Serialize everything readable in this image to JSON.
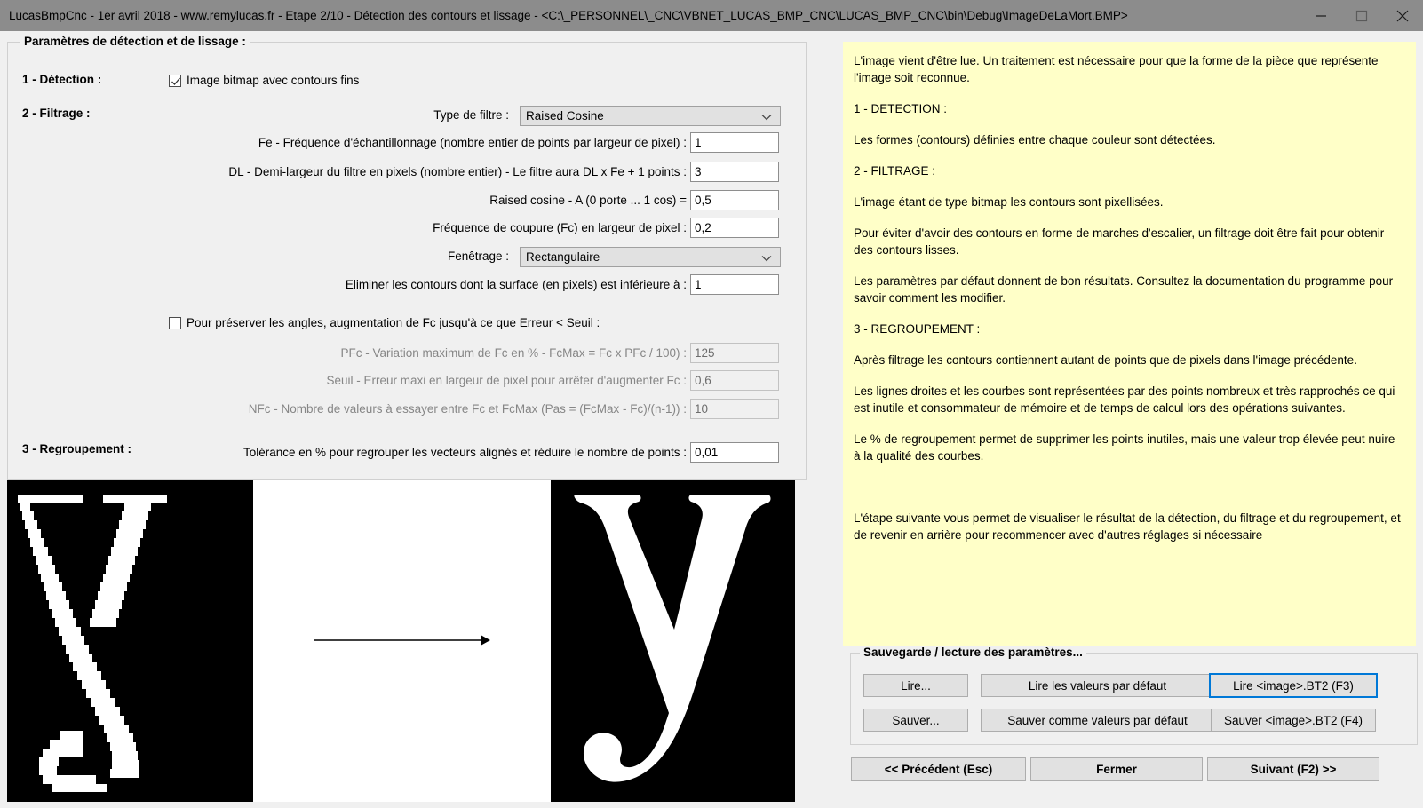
{
  "window": {
    "title": "LucasBmpCnc - 1er avril 2018 - www.remylucas.fr - Etape 2/10 - Détection des contours et lissage - <C:\\_PERSONNEL\\_CNC\\VBNET_LUCAS_BMP_CNC\\LUCAS_BMP_CNC\\bin\\Debug\\ImageDeLaMort.BMP>",
    "titlebar_color": "#8c8c8c",
    "minimize_icon": "minimize-icon",
    "maximize_icon": "maximize-icon",
    "close_icon": "close-icon"
  },
  "params_group": {
    "title": "Paramètres de détection et de lissage :",
    "section1_label": "1 - Détection :",
    "section2_label": "2 - Filtrage :",
    "section3_label": "3 - Regroupement :",
    "checkbox_thin_contours": {
      "label": "Image bitmap avec contours fins",
      "checked": true
    },
    "filter_type": {
      "label": "Type de filtre :",
      "value": "Raised Cosine"
    },
    "fe": {
      "label": "Fe - Fréquence d'échantillonnage (nombre entier de points par largeur de pixel) :",
      "value": "1"
    },
    "dl": {
      "label": "DL - Demi-largeur du filtre en pixels (nombre entier) - Le filtre aura DL x Fe + 1 points :",
      "value": "3"
    },
    "raised_cosine_a": {
      "label": "Raised cosine - A (0 porte ... 1 cos) =",
      "value": "0,5"
    },
    "fc": {
      "label": "Fréquence de coupure (Fc) en largeur de pixel :",
      "value": "0,2"
    },
    "windowing": {
      "label": "Fenêtrage :",
      "value": "Rectangulaire"
    },
    "min_surface": {
      "label": "Eliminer les contours dont la surface (en pixels) est inférieure à :",
      "value": "1"
    },
    "checkbox_preserve_angles": {
      "label": "Pour préserver les angles, augmentation de Fc jusqu'à ce que Erreur < Seuil :",
      "checked": false
    },
    "pfc": {
      "label": "PFc - Variation maximum de Fc en % - FcMax = Fc x PFc / 100) :",
      "value": "125",
      "disabled": true
    },
    "seuil": {
      "label": "Seuil - Erreur maxi en largeur de pixel pour arrêter d'augmenter Fc :",
      "value": "0,6",
      "disabled": true
    },
    "nfc": {
      "label": "NFc - Nombre de valeurs à essayer entre Fc et FcMax (Pas = (FcMax - Fc)/(n-1)) :",
      "value": "10",
      "disabled": true
    },
    "tolerance": {
      "label": "Tolérance en % pour regrouper les vecteurs alignés et réduire le nombre de points :",
      "value": "0,01"
    }
  },
  "preview": {
    "left_image_alt": "lettre-y-pixelisee",
    "right_image_alt": "lettre-y-lissee",
    "arrow_icon": "arrow-right-icon"
  },
  "help": {
    "background_color": "#ffffc8",
    "paragraphs": [
      "L'image vient d'être lue. Un traitement est nécessaire pour que la forme de la pièce que représente l'image soit reconnue.",
      "1 - DETECTION :",
      "Les formes (contours) définies entre chaque couleur sont détectées.",
      "2 - FILTRAGE :",
      "L'image étant de type bitmap les contours sont pixellisées.",
      "Pour éviter d'avoir des contours en forme de marches d'escalier, un filtrage doit être fait pour obtenir des contours lisses.",
      "Les paramètres par défaut donnent de bon résultats. Consultez la documentation du programme pour savoir comment les modifier.",
      "3 - REGROUPEMENT :",
      "Après filtrage les contours contiennent autant de points que de pixels dans l'image précédente.",
      "Les lignes droites et les courbes sont représentées par des points nombreux et très rapprochés ce qui est inutile et consommateur de mémoire et de temps de calcul lors des opérations suivantes.",
      "Le % de regroupement permet de supprimer les points inutiles, mais une valeur trop élevée peut nuire à la qualité des courbes.",
      "",
      "L'étape suivante vous permet de visualiser le résultat de la détection, du filtrage et du regroupement, et de revenir en arrière pour recommencer avec d'autres réglages si nécessaire"
    ]
  },
  "save_group": {
    "title": "Sauvegarde / lecture des paramètres...",
    "read_button": "Lire...",
    "read_defaults_button": "Lire les valeurs par défaut",
    "read_bt2_button": "Lire <image>.BT2 (F3)",
    "save_button": "Sauver...",
    "save_defaults_button": "Sauver comme valeurs par défaut",
    "save_bt2_button": "Sauver <image>.BT2 (F4)",
    "focus_color": "#0078d7"
  },
  "nav": {
    "previous_button": "<< Précédent (Esc)",
    "close_button": "Fermer",
    "next_button": "Suivant (F2) >>"
  }
}
